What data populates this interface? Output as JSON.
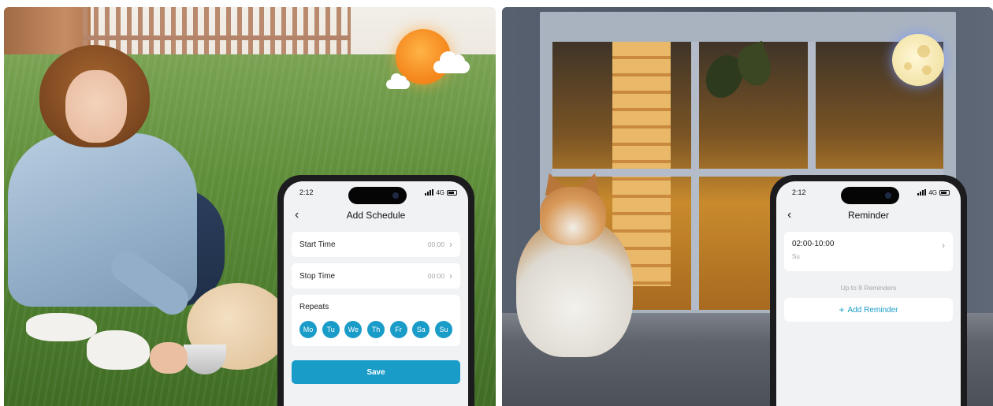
{
  "left_phone": {
    "time": "2:12",
    "network": "4G",
    "title": "Add Schedule",
    "start_time": {
      "label": "Start Time",
      "value": "00:00"
    },
    "stop_time": {
      "label": "Stop Time",
      "value": "00:00"
    },
    "repeats": {
      "label": "Repeats",
      "days": [
        "Mo",
        "Tu",
        "We",
        "Th",
        "Fr",
        "Sa",
        "Su"
      ]
    },
    "save_label": "Save"
  },
  "right_phone": {
    "time": "2:12",
    "network": "4G",
    "title": "Reminder",
    "reminder": {
      "time_range": "02:00-10:00",
      "days": "Su"
    },
    "limit_text": "Up to 8 Reminders",
    "add_label": "Add Reminder"
  },
  "colors": {
    "accent": "#1a9cc9",
    "screen_bg": "#f1f2f4"
  },
  "icons": {
    "back": "chevron-left-icon",
    "row": "chevron-right-icon",
    "add": "plus-icon",
    "day_scene": "sun-icon",
    "night_scene": "moon-icon"
  }
}
